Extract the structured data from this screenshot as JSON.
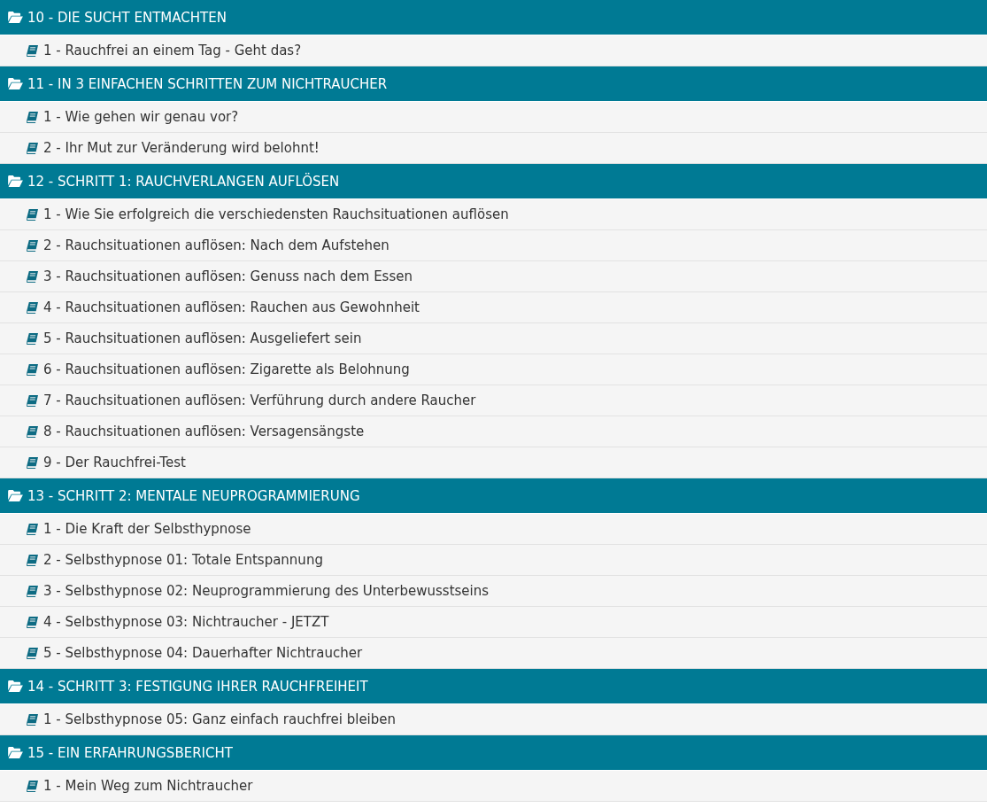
{
  "sections": [
    {
      "title": "10 - DIE SUCHT ENTMACHTEN",
      "lessons": [
        "1 - Rauchfrei an einem Tag - Geht das?"
      ]
    },
    {
      "title": "11 - IN 3 EINFACHEN SCHRITTEN ZUM NICHTRAUCHER",
      "lessons": [
        "1 - Wie gehen wir genau vor?",
        "2 - Ihr Mut zur Veränderung wird belohnt!"
      ]
    },
    {
      "title": "12 - SCHRITT 1: RAUCHVERLANGEN AUFLÖSEN",
      "lessons": [
        "1 - Wie Sie erfolgreich die verschiedensten Rauchsituationen auflösen",
        "2 - Rauchsituationen auflösen: Nach dem Aufstehen",
        "3 - Rauchsituationen auflösen: Genuss nach dem Essen",
        "4 - Rauchsituationen auflösen: Rauchen aus Gewohnheit",
        "5 - Rauchsituationen auflösen: Ausgeliefert sein",
        "6 - Rauchsituationen auflösen: Zigarette als Belohnung",
        "7 - Rauchsituationen auflösen: Verführung durch andere Raucher",
        "8 - Rauchsituationen auflösen: Versagensängste",
        "9 - Der Rauchfrei-Test"
      ]
    },
    {
      "title": "13 - SCHRITT 2: MENTALE NEUPROGRAMMIERUNG",
      "lessons": [
        "1 - Die Kraft der Selbsthypnose",
        "2 - Selbsthypnose 01: Totale Entspannung",
        "3 - Selbsthypnose 02: Neuprogrammierung des Unterbewusstseins",
        "4 - Selbsthypnose 03: Nichtraucher - JETZT",
        "5 - Selbsthypnose 04: Dauerhafter Nichtraucher"
      ]
    },
    {
      "title": "14 - SCHRITT 3: FESTIGUNG IHRER RAUCHFREIHEIT",
      "lessons": [
        "1 - Selbsthypnose 05: Ganz einfach rauchfrei bleiben"
      ]
    },
    {
      "title": "15 - EIN ERFAHRUNGSBERICHT",
      "lessons": [
        "1 - Mein Weg zum Nichtraucher"
      ]
    }
  ]
}
